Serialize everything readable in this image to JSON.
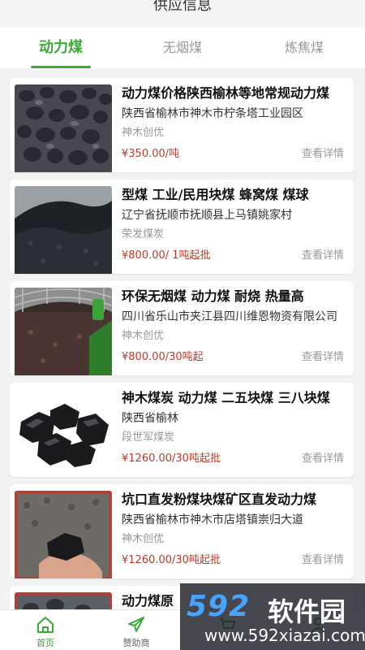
{
  "header": {
    "title": "供应信息"
  },
  "tabs": [
    {
      "label": "动力煤",
      "active": true
    },
    {
      "label": "无烟煤",
      "active": false
    },
    {
      "label": "炼焦煤",
      "active": false
    }
  ],
  "products": [
    {
      "name": "动力煤价格陕西榆林等地常规动力煤",
      "address": "陕西省榆林市神木市柠条塔工业园区",
      "seller": "神木创优",
      "price": "¥350.00/吨",
      "detail": "查看详情"
    },
    {
      "name": "型煤 工业/民用块煤 蜂窝煤 煤球",
      "address": "辽宁省抚顺市抚顺县上马镇姚家村",
      "seller": "荣发煤炭",
      "price": "¥800.00/ 1吨起批",
      "detail": "查看详情"
    },
    {
      "name": "环保无烟煤 动力煤 耐烧 热量高",
      "address": "四川省乐山市夹江县四川维恩物资有限公司",
      "seller": "神木创优",
      "price": "¥800.00/30吨起",
      "detail": "查看详情"
    },
    {
      "name": "神木煤炭 动力煤 二五块煤 三八块煤",
      "address": "陕西省榆林",
      "seller": "段世军煤炭",
      "price": "¥1260.00/30吨起批",
      "detail": "查看详情"
    },
    {
      "name": "坑口直发粉煤块煤矿区直发动力煤",
      "address": "陕西省榆林市神木市店塔镇崇归大道",
      "seller": "神木创优",
      "price": "¥1260.00/30吨起批",
      "detail": "查看详情"
    },
    {
      "name": "动力煤原",
      "address": "",
      "seller": "",
      "price": "",
      "detail": ""
    }
  ],
  "nav": [
    {
      "label": "首页",
      "icon": "home-icon",
      "active": true
    },
    {
      "label": "赞助商",
      "icon": "paper-plane-icon",
      "active": false
    },
    {
      "label": "",
      "icon": "cart-icon",
      "active": false
    },
    {
      "label": "",
      "icon": "user-icon",
      "active": false
    }
  ],
  "watermark": {
    "logo": "592",
    "text": "软件园",
    "url": "www.592xiazai.com"
  },
  "colors": {
    "accent": "#3aaa35",
    "price": "#c03a2b",
    "background": "#f2f2f2"
  }
}
